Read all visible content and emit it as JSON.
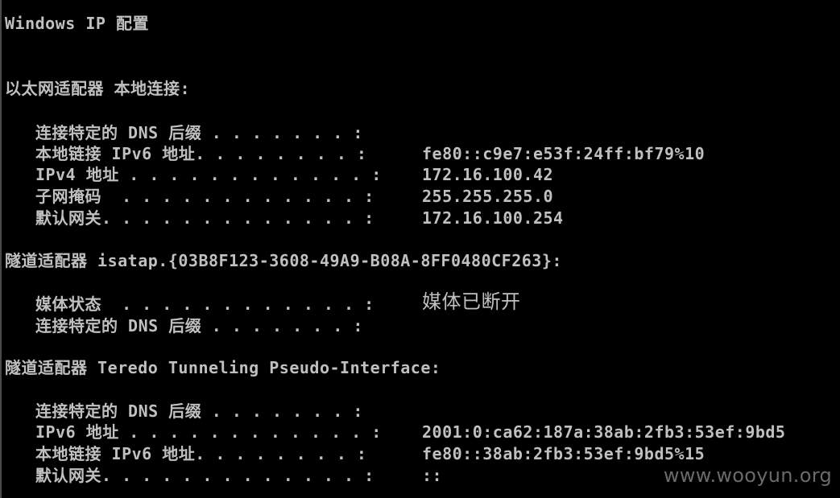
{
  "console": {
    "title": "Windows IP 配置",
    "sections": [
      {
        "header": "以太网适配器 本地连接:",
        "rows": [
          {
            "label": "连接特定的 DNS 后缀 . . . . . . . :",
            "value": ""
          },
          {
            "label": "本地链接 IPv6 地址. . . . . . . . :",
            "value": "fe80::c9e7:e53f:24ff:bf79%10"
          },
          {
            "label": "IPv4 地址 . . . . . . . . . . . . :",
            "value": "172.16.100.42"
          },
          {
            "label": "子网掩码  . . . . . . . . . . . . :",
            "value": "255.255.255.0"
          },
          {
            "label": "默认网关. . . . . . . . . . . . . :",
            "value": "172.16.100.254"
          }
        ]
      },
      {
        "header": "隧道适配器 isatap.{03B8F123-3608-49A9-B08A-8FF0480CF263}:",
        "rows": [
          {
            "label": "媒体状态  . . . . . . . . . . . . :",
            "value": "媒体已断开"
          },
          {
            "label": "连接特定的 DNS 后缀 . . . . . . . :",
            "value": ""
          }
        ]
      },
      {
        "header": "隧道适配器 Teredo Tunneling Pseudo-Interface:",
        "rows": [
          {
            "label": "连接特定的 DNS 后缀 . . . . . . . :",
            "value": ""
          },
          {
            "label": "IPv6 地址 . . . . . . . . . . . . :",
            "value": "2001:0:ca62:187a:38ab:2fb3:53ef:9bd5"
          },
          {
            "label": "本地链接 IPv6 地址. . . . . . . . :",
            "value": "fe80::38ab:2fb3:53ef:9bd5%15"
          },
          {
            "label": "默认网关. . . . . . . . . . . . . :",
            "value": "::"
          }
        ]
      }
    ]
  },
  "watermark": "www.wooyun.org",
  "colors": {
    "background": "#000000",
    "text": "#c0c0c0",
    "watermark": "#6a6a6a"
  }
}
